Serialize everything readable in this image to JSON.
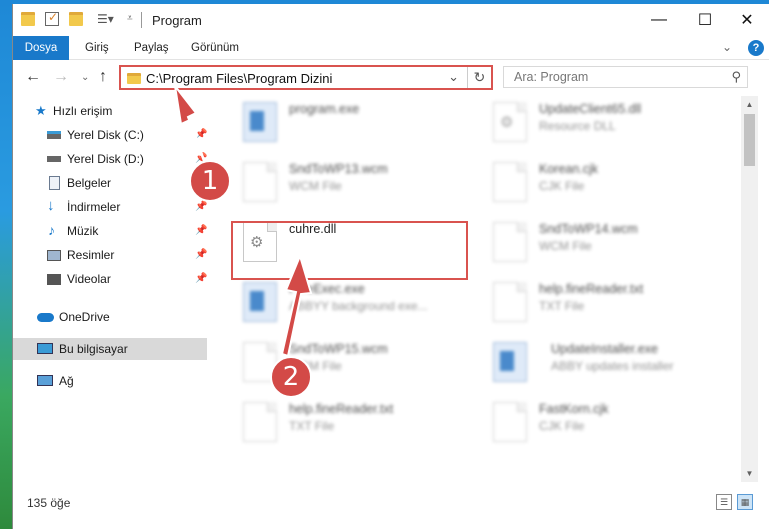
{
  "window": {
    "title": "Program",
    "controls": {
      "minimize": "—",
      "maximize": "☐",
      "close": "✕"
    }
  },
  "ribbon": {
    "tabs": [
      "Dosya",
      "Giriş",
      "Paylaş",
      "Görünüm"
    ],
    "expand": "⌄",
    "help": "?"
  },
  "nav": {
    "back": "←",
    "forward": "→",
    "recent": "⌄",
    "up": "↑",
    "address": "C:\\Program Files\\Program Dizini",
    "dropdown": "⌄",
    "refresh": "↻",
    "search_placeholder": "Ara: Program",
    "search_icon": "⚲"
  },
  "sidebar": {
    "items": [
      {
        "label": "Hızlı erişim",
        "icon": "star-icon",
        "pinned": false
      },
      {
        "label": "Yerel Disk (C:)",
        "icon": "drive-icon",
        "pinned": true
      },
      {
        "label": "Yerel Disk (D:)",
        "icon": "drive-icon",
        "pinned": true
      },
      {
        "label": "Belgeler",
        "icon": "documents-icon",
        "pinned": true
      },
      {
        "label": "İndirmeler",
        "icon": "download-icon",
        "pinned": true
      },
      {
        "label": "Müzik",
        "icon": "music-icon",
        "pinned": true
      },
      {
        "label": "Resimler",
        "icon": "pictures-icon",
        "pinned": true
      },
      {
        "label": "Videolar",
        "icon": "videos-icon",
        "pinned": true
      },
      {
        "label": "OneDrive",
        "icon": "cloud-icon",
        "pinned": false
      },
      {
        "label": "Bu bilgisayar",
        "icon": "computer-icon",
        "pinned": false
      },
      {
        "label": "Ağ",
        "icon": "network-icon",
        "pinned": false
      }
    ],
    "pin_glyph": "📌"
  },
  "files": [
    {
      "name": "program.exe",
      "type": "",
      "kind": "app",
      "blurred": true
    },
    {
      "name": "UpdateClient65.dll",
      "type": "Resource DLL",
      "kind": "dll",
      "blurred": true
    },
    {
      "name": "SndToWP13.wcm",
      "type": "WCM File",
      "kind": "doc",
      "blurred": true
    },
    {
      "name": "Korean.cjk",
      "type": "CJK File",
      "kind": "doc",
      "blurred": true
    },
    {
      "name": "cuhre.dll",
      "type": "",
      "kind": "dll",
      "blurred": false
    },
    {
      "name": "SndToWP14.wcm",
      "type": "WCM File",
      "kind": "doc",
      "blurred": true
    },
    {
      "name": "FineExec.exe",
      "type": "ABBYY background exe...",
      "kind": "app",
      "blurred": true
    },
    {
      "name": "help.fineReader.txt",
      "type": "TXT File",
      "kind": "doc",
      "blurred": true
    },
    {
      "name": "SndToWP15.wcm",
      "type": "WCM File",
      "kind": "doc",
      "blurred": true
    },
    {
      "name": "UpdateInstaller.exe",
      "type": "ABBY updates installer",
      "kind": "app",
      "blurred": true
    },
    {
      "name": "help.fineReader.txt",
      "type": "TXT File",
      "kind": "doc",
      "blurred": true
    },
    {
      "name": "FastKorn.cjk",
      "type": "CJK File",
      "kind": "doc",
      "blurred": true
    }
  ],
  "status": {
    "count": "135 öğe",
    "details_view": "☰",
    "icons_view": "▦"
  },
  "annotations": {
    "badge1": "1",
    "badge2": "2"
  },
  "colors": {
    "accent": "#1979ca",
    "annotation": "#d34a47"
  }
}
